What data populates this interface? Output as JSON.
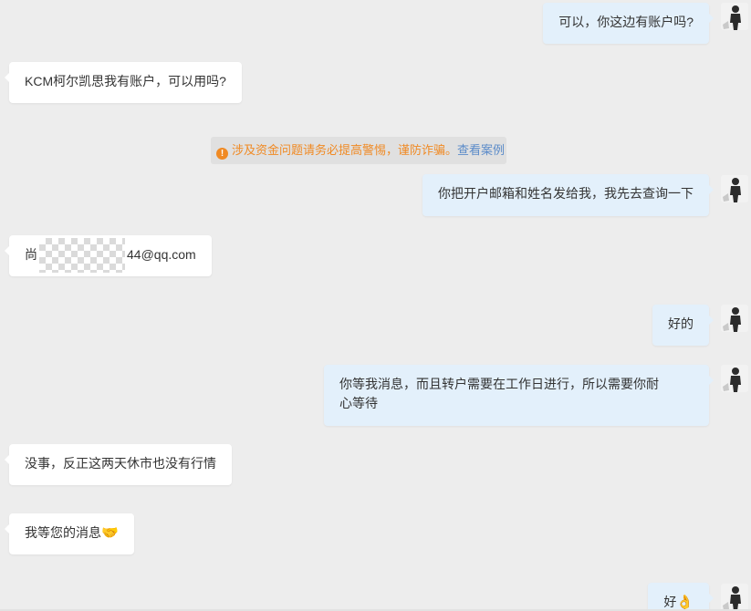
{
  "messages": {
    "m1": "可以，你这边有账户吗?",
    "m2": "KCM柯尔凯思我有账户，可以用吗?",
    "m3": "你把开户邮箱和姓名发给我，我先去查询一下",
    "m4_prefix": "尚",
    "m4_suffix": "44@qq.com",
    "m5": "好的",
    "m6_line1": "你等我消息，而且转户需要在工作日进行，所以需要你耐",
    "m6_line2": "心等待",
    "m7": "没事，反正这两天休市也没有行情",
    "m8_text": "我等您的消息",
    "m8_emoji": "🤝",
    "m9_text": "好",
    "m9_emoji": "👌"
  },
  "notice": {
    "icon": "!",
    "text": "涉及资金问题请务必提高警惕，谨防诈骗。",
    "link": "查看案例"
  },
  "colors": {
    "background": "#ededed",
    "incoming_bubble": "#ffffff",
    "outgoing_bubble": "#e3f0fb",
    "warning": "#f08a24",
    "link": "#5b8bc9"
  }
}
